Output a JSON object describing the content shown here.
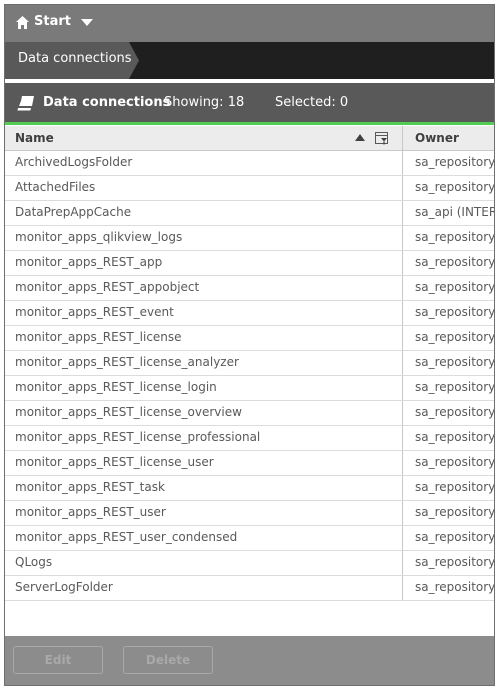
{
  "topbar": {
    "start_label": "Start"
  },
  "breadcrumb": {
    "current": "Data connections"
  },
  "section": {
    "title": "Data connections",
    "showing": "Showing: 18",
    "selected": "Selected: 0",
    "accent_color": "#52cc52"
  },
  "table": {
    "columns": {
      "name": "Name",
      "owner": "Owner"
    },
    "rows": [
      {
        "name": "ArchivedLogsFolder",
        "owner": "sa_repository ("
      },
      {
        "name": "AttachedFiles",
        "owner": "sa_repository ("
      },
      {
        "name": "DataPrepAppCache",
        "owner": "sa_api (INTER"
      },
      {
        "name": "monitor_apps_qlikview_logs",
        "owner": "sa_repository ("
      },
      {
        "name": "monitor_apps_REST_app",
        "owner": "sa_repository ("
      },
      {
        "name": "monitor_apps_REST_appobject",
        "owner": "sa_repository ("
      },
      {
        "name": "monitor_apps_REST_event",
        "owner": "sa_repository ("
      },
      {
        "name": "monitor_apps_REST_license",
        "owner": "sa_repository ("
      },
      {
        "name": "monitor_apps_REST_license_analyzer",
        "owner": "sa_repository ("
      },
      {
        "name": "monitor_apps_REST_license_login",
        "owner": "sa_repository ("
      },
      {
        "name": "monitor_apps_REST_license_overview",
        "owner": "sa_repository ("
      },
      {
        "name": "monitor_apps_REST_license_professional",
        "owner": "sa_repository ("
      },
      {
        "name": "monitor_apps_REST_license_user",
        "owner": "sa_repository ("
      },
      {
        "name": "monitor_apps_REST_task",
        "owner": "sa_repository ("
      },
      {
        "name": "monitor_apps_REST_user",
        "owner": "sa_repository ("
      },
      {
        "name": "monitor_apps_REST_user_condensed",
        "owner": "sa_repository ("
      },
      {
        "name": "QLogs",
        "owner": "sa_repository ("
      },
      {
        "name": "ServerLogFolder",
        "owner": "sa_repository ("
      }
    ]
  },
  "footer": {
    "edit_label": "Edit",
    "delete_label": "Delete"
  },
  "icons": {
    "home": "home-icon",
    "menu_caret": "chevron-down-icon",
    "section": "data-connection-icon",
    "sort": "sort-ascending-icon",
    "filter": "column-filter-icon"
  }
}
